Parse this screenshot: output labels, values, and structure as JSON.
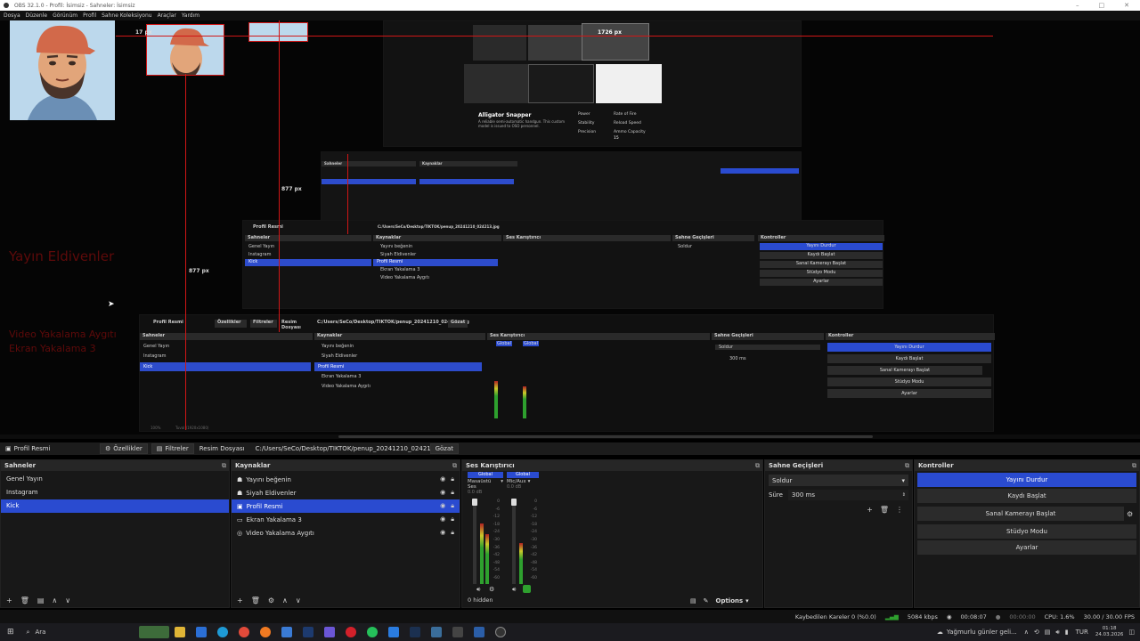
{
  "window": {
    "title": "OBS 32.1.0 - Profil: İsimsiz - Sahneler: İsimsiz",
    "menu": [
      "Dosya",
      "Düzenle",
      "Görünüm",
      "Profil",
      "Sahne Koleksiyonu",
      "Araçlar",
      "Yardım"
    ]
  },
  "preview": {
    "measurements": [
      "17 px",
      "1726 px",
      "877 px",
      "877 px",
      "877 px"
    ],
    "faded_labels": [
      "Yayın Eldivenler",
      "Video Yakalama Aygıtı",
      "Ekran Yakalama 3"
    ],
    "nested_texts": {
      "sources_bar": [
        "Profil Resmi",
        "Özellikler",
        "Filtreler",
        "Resim Dosyası",
        "C:/Users/SeCo/Desktop/TIKTOK/penup_20241210_024213.jpg",
        "Gözat"
      ],
      "scenes": [
        "Sahneler",
        "Genel Yayın",
        "Instagram",
        "Kick"
      ],
      "sources": [
        "Kaynaklar",
        "Yayını beğenin",
        "Siyah Eldivenler",
        "Profil Resmi",
        "Ekran Yakalama 3",
        "Video Yakalama Aygıtı"
      ],
      "mixer": [
        "Ses Karıştırıcı",
        "Global",
        "Global",
        "Masaüstü Ses",
        "Mic/Aux"
      ],
      "transitions": [
        "Sahne Geçişleri",
        "Soldur",
        "Süre",
        "300 ms"
      ],
      "controls": [
        "Kontroller",
        "Yayını Durdur",
        "Kaydı Başlat",
        "Sanal Kamerayı Başlat",
        "Stüdyo Modu",
        "Ayarlar"
      ],
      "zoom": [
        "100%",
        "Tuval (1920x1080)"
      ],
      "alligator": {
        "title": "Alligator Snapper",
        "desc": "A reliable semi-automatic handgun. This custom model is issued to OSO personnel.",
        "stats": [
          "Power",
          "Rate of Fire",
          "Stability",
          "Reload Speed",
          "Precision",
          "Ammo Capacity"
        ],
        "ammo": "15"
      }
    }
  },
  "sourcebar": {
    "source_name": "Profil Resmi",
    "properties_label": "Özellikler",
    "filters_label": "Filtreler",
    "type_label": "Resim Dosyası",
    "path": "C:/Users/SeCo/Desktop/TIKTOK/penup_20241210_024213.jpg",
    "browse_label": "Gözat"
  },
  "scenes": {
    "title": "Sahneler",
    "items": [
      "Genel Yayın",
      "Instagram",
      "Kick"
    ],
    "selected_index": 2
  },
  "sources": {
    "title": "Kaynaklar",
    "items": [
      {
        "label": "Yayını beğenin",
        "icon": "text-icon"
      },
      {
        "label": "Siyah Eldivenler",
        "icon": "text-icon"
      },
      {
        "label": "Profil Resmi",
        "icon": "image-icon"
      },
      {
        "label": "Ekran Yakalama 3",
        "icon": "monitor-icon"
      },
      {
        "label": "Video Yakalama Aygıtı",
        "icon": "camera-icon"
      }
    ],
    "selected_index": 2
  },
  "mixer": {
    "title": "Ses Karıştırıcı",
    "channels": [
      {
        "header": "Global",
        "name": "Masaüstü Ses",
        "db": "0.0 dB"
      },
      {
        "header": "Global",
        "name": "Mic/Aux",
        "db": "0.0 dB"
      }
    ],
    "scale": [
      "0",
      "-6",
      "-12",
      "-18",
      "-24",
      "-30",
      "-36",
      "-42",
      "-48",
      "-54",
      "-60"
    ],
    "hidden_label": "0 hidden"
  },
  "transitions": {
    "title": "Sahne Geçişleri",
    "type": "Soldur",
    "duration_label": "Süre",
    "duration_value": "300 ms"
  },
  "controls": {
    "title": "Kontroller",
    "buttons": [
      "Yayını Durdur",
      "Kaydı Başlat",
      "Sanal Kamerayı Başlat",
      "Stüdyo Modu",
      "Ayarlar"
    ]
  },
  "dock_footer": {
    "options_label": "Options"
  },
  "status": {
    "dropped": "Kaybedilen Kareler 0 (%0.0)",
    "bitrate": "5084 kbps",
    "stream_time": "00:08:07",
    "rec_time": "00:00:00",
    "cpu": "CPU: 1.6%",
    "fps": "30.00 / 30.00 FPS"
  },
  "taskbar": {
    "search_placeholder": "Ara",
    "weather": "Yağmurlu günler geli...",
    "lang": "TUR",
    "time": "01:18",
    "date": "24.03.2026"
  },
  "colors": {
    "accent": "#2a4bd0",
    "guide_red": "#d01616",
    "dock_bg": "#181818"
  }
}
